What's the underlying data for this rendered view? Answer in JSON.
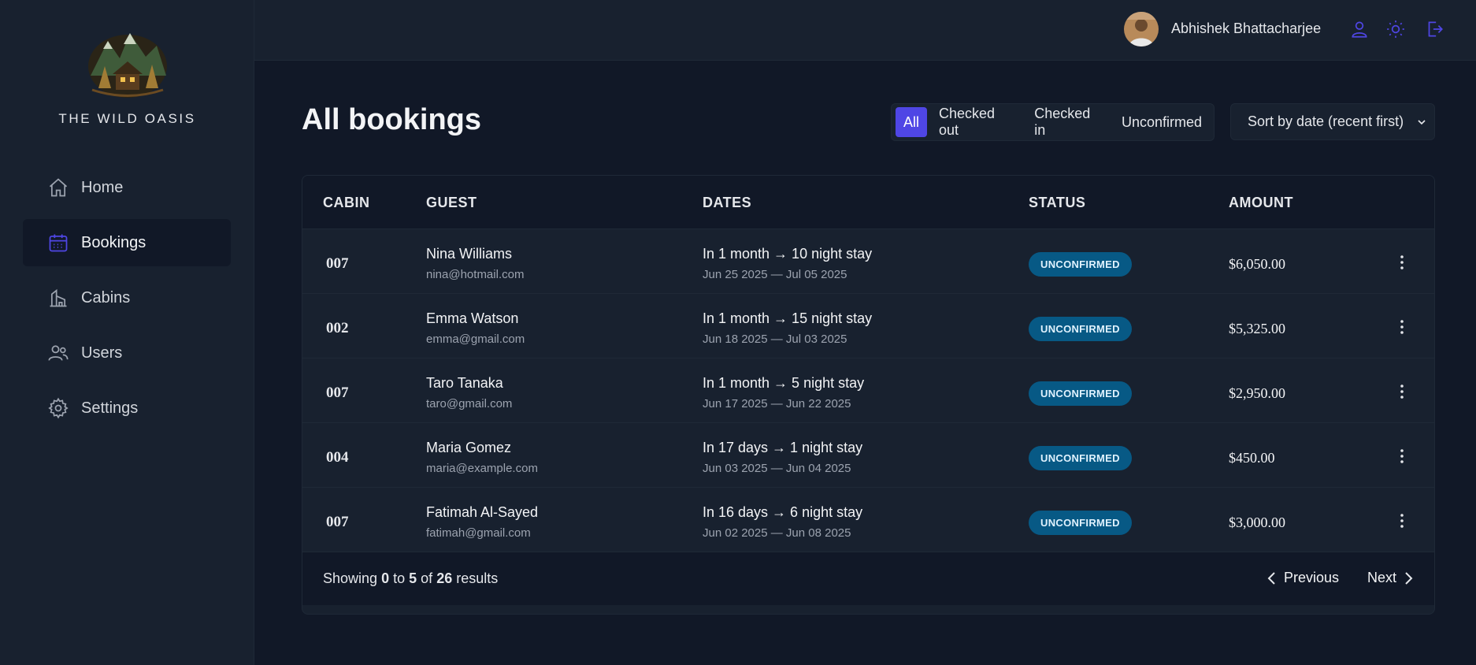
{
  "sidebar": {
    "brand": "THE WILD OASIS",
    "items": [
      {
        "label": "Home",
        "icon": "home-icon"
      },
      {
        "label": "Bookings",
        "icon": "calendar-icon",
        "active": true
      },
      {
        "label": "Cabins",
        "icon": "cabin-icon"
      },
      {
        "label": "Users",
        "icon": "users-icon"
      },
      {
        "label": "Settings",
        "icon": "gear-icon"
      }
    ]
  },
  "header": {
    "user_name": "Abhishek Bhattacharjee",
    "icons": [
      "user-icon",
      "sun-icon",
      "logout-icon"
    ]
  },
  "main": {
    "title": "All bookings",
    "filters": [
      {
        "label": "All",
        "active": true
      },
      {
        "label": "Checked out"
      },
      {
        "label": "Checked in"
      },
      {
        "label": "Unconfirmed"
      }
    ],
    "sort_label": "Sort by date (recent first)"
  },
  "table": {
    "headers": [
      "CABIN",
      "GUEST",
      "DATES",
      "STATUS",
      "AMOUNT"
    ],
    "rows": [
      {
        "cabin": "007",
        "guest": "Nina Williams",
        "email": "nina@hotmail.com",
        "dates": "In 1 month → 10 night stay",
        "range": "Jun 25 2025 — Jul 05 2025",
        "status": "UNCONFIRMED",
        "amount": "$6,050.00"
      },
      {
        "cabin": "002",
        "guest": "Emma Watson",
        "email": "emma@gmail.com",
        "dates": "In 1 month → 15 night stay",
        "range": "Jun 18 2025 — Jul 03 2025",
        "status": "UNCONFIRMED",
        "amount": "$5,325.00"
      },
      {
        "cabin": "007",
        "guest": "Taro Tanaka",
        "email": "taro@gmail.com",
        "dates": "In 1 month → 5 night stay",
        "range": "Jun 17 2025 — Jun 22 2025",
        "status": "UNCONFIRMED",
        "amount": "$2,950.00"
      },
      {
        "cabin": "004",
        "guest": "Maria Gomez",
        "email": "maria@example.com",
        "dates": "In 17 days → 1 night stay",
        "range": "Jun 03 2025 — Jun 04 2025",
        "status": "UNCONFIRMED",
        "amount": "$450.00"
      },
      {
        "cabin": "007",
        "guest": "Fatimah Al-Sayed",
        "email": "fatimah@gmail.com",
        "dates": "In 16 days → 6 night stay",
        "range": "Jun 02 2025 — Jun 08 2025",
        "status": "UNCONFIRMED",
        "amount": "$3,000.00"
      }
    ]
  },
  "footer": {
    "showing_prefix": "Showing",
    "from": "0",
    "to_word": "to",
    "to": "5",
    "of_word": "of",
    "total": "26",
    "results_word": "results",
    "previous": "Previous",
    "next": "Next"
  },
  "colors": {
    "background": "#111827",
    "panel": "#18212f",
    "accent": "#4f46e5",
    "badge": "#075985"
  }
}
